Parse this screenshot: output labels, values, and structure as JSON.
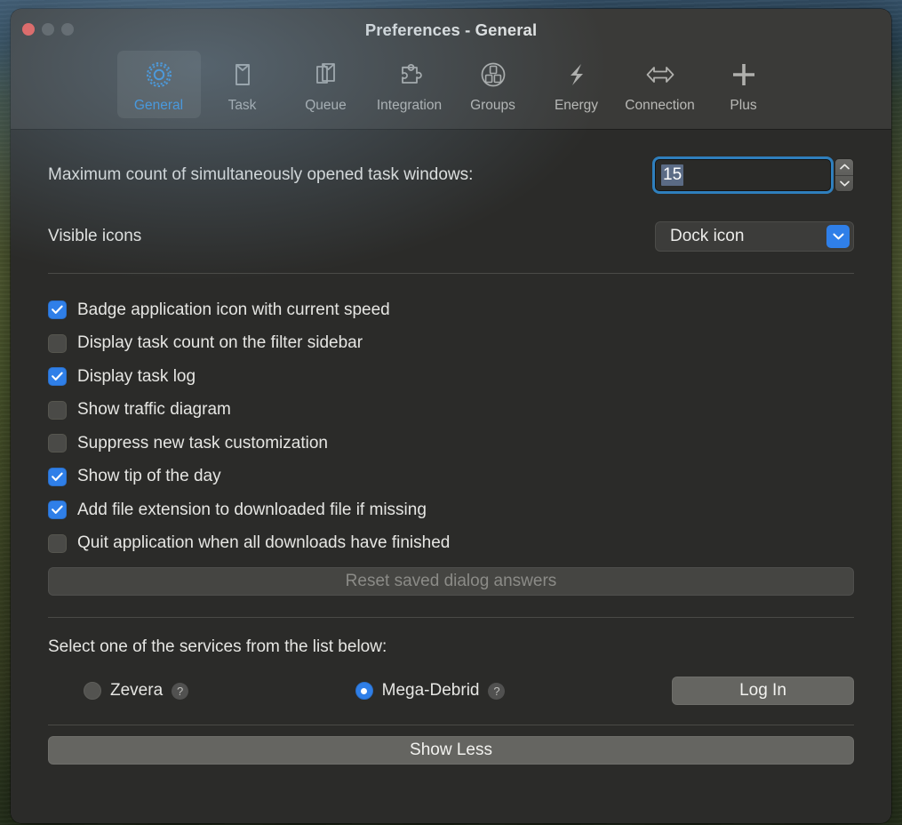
{
  "window": {
    "title": "Preferences - General",
    "traffic_lights": [
      {
        "name": "close",
        "color": "#fc5f57"
      },
      {
        "name": "minimize",
        "color": "#5e5e5c"
      },
      {
        "name": "zoom",
        "color": "#5e5e5c"
      }
    ],
    "accent_color": "#2f7fe8",
    "background_color": "#2b2b29"
  },
  "toolbar": {
    "selected": "General",
    "items": [
      {
        "label": "General",
        "icon": "gear-icon"
      },
      {
        "label": "Task",
        "icon": "document-icon"
      },
      {
        "label": "Queue",
        "icon": "stacked-documents-icon"
      },
      {
        "label": "Integration",
        "icon": "puzzle-piece-icon"
      },
      {
        "label": "Groups",
        "icon": "circle-documents-icon"
      },
      {
        "label": "Energy",
        "icon": "lightning-bolt-icon"
      },
      {
        "label": "Connection",
        "icon": "double-arrow-icon"
      },
      {
        "label": "Plus",
        "icon": "plus-icon"
      }
    ]
  },
  "settings": {
    "max_windows_label": "Maximum count of simultaneously opened task windows:",
    "max_windows_value": "15",
    "visible_icons_label": "Visible icons",
    "visible_icons_value": "Dock icon",
    "visible_icons_options": [
      "Dock icon"
    ]
  },
  "checkboxes": [
    {
      "label": "Badge application icon with current speed",
      "checked": true
    },
    {
      "label": "Display task count on the filter sidebar",
      "checked": false
    },
    {
      "label": "Display task log",
      "checked": true
    },
    {
      "label": "Show traffic diagram",
      "checked": false
    },
    {
      "label": "Suppress new task customization",
      "checked": false
    },
    {
      "label": "Show tip of the day",
      "checked": true
    },
    {
      "label": "Add file extension to downloaded file if missing",
      "checked": true
    },
    {
      "label": "Quit application when all downloads have finished",
      "checked": false
    }
  ],
  "reset_button": {
    "label": "Reset saved dialog answers",
    "disabled": true
  },
  "services": {
    "title": "Select one of the services from the list below:",
    "options": [
      {
        "label": "Zevera",
        "selected": false,
        "help": "?"
      },
      {
        "label": "Mega-Debrid",
        "selected": true,
        "help": "?"
      }
    ],
    "login_label": "Log In"
  },
  "footer": {
    "show_less_label": "Show Less"
  }
}
